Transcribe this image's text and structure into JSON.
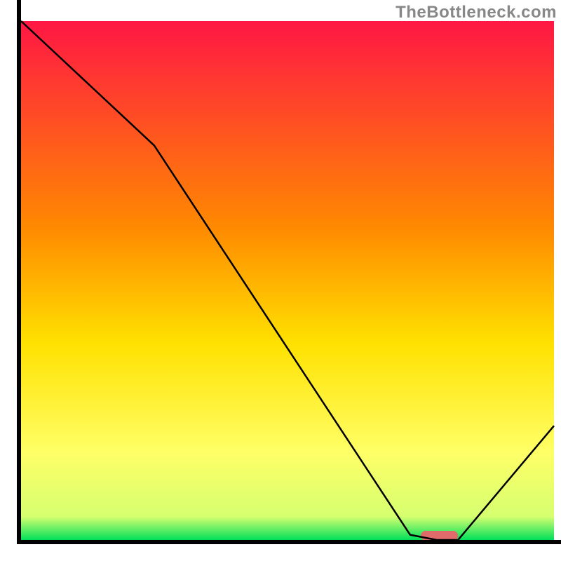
{
  "watermark": "TheBottleneck.com",
  "chart_data": {
    "type": "line",
    "title": "",
    "xlabel": "",
    "ylabel": "",
    "xlim": [
      0,
      100
    ],
    "ylim": [
      0,
      100
    ],
    "x": [
      0,
      25,
      73,
      78,
      82,
      100
    ],
    "values": [
      100,
      76,
      1,
      0,
      0,
      22
    ],
    "marker": {
      "x_start": 75,
      "x_end": 82,
      "y": 0,
      "color": "#e16a6a"
    },
    "gradient_stops": [
      {
        "offset": 0,
        "color": "#ff1744"
      },
      {
        "offset": 0.4,
        "color": "#ff8a00"
      },
      {
        "offset": 0.62,
        "color": "#ffe100"
      },
      {
        "offset": 0.83,
        "color": "#ffff66"
      },
      {
        "offset": 0.955,
        "color": "#d6ff70"
      },
      {
        "offset": 1.0,
        "color": "#00e05a"
      }
    ],
    "axis_color": "#000000",
    "line_color": "#000000"
  }
}
